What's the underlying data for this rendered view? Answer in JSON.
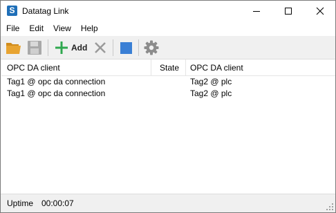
{
  "window": {
    "title": "Datatag Link",
    "app_icon_glyph": "S",
    "app_icon_name": "datatag-app-icon",
    "controls": [
      "minimize",
      "maximize",
      "close"
    ]
  },
  "menu": {
    "items": [
      {
        "label": "File"
      },
      {
        "label": "Edit"
      },
      {
        "label": "View"
      },
      {
        "label": "Help"
      }
    ]
  },
  "toolbar": {
    "open_icon": "folder-open-icon",
    "save_icon": "save-icon",
    "add_label": "Add",
    "remove_icon": "delete-x-icon",
    "stop_icon": "stop-square-icon",
    "settings_icon": "gear-icon",
    "colors": {
      "folder": "#e8a431",
      "add": "#2fa84f",
      "remove": "#9a9a9a",
      "stop": "#3a7fd5",
      "gear": "#8c8c8c"
    }
  },
  "table": {
    "columns": [
      "OPC DA client",
      "State",
      "OPC DA client"
    ],
    "rows": [
      [
        "Tag1 @ opc da connection",
        "",
        "Tag2 @ plc"
      ],
      [
        "Tag1 @ opc da connection",
        "",
        "Tag2 @ plc"
      ]
    ]
  },
  "status": {
    "uptime_label": "Uptime",
    "uptime_value": "00:00:07"
  }
}
